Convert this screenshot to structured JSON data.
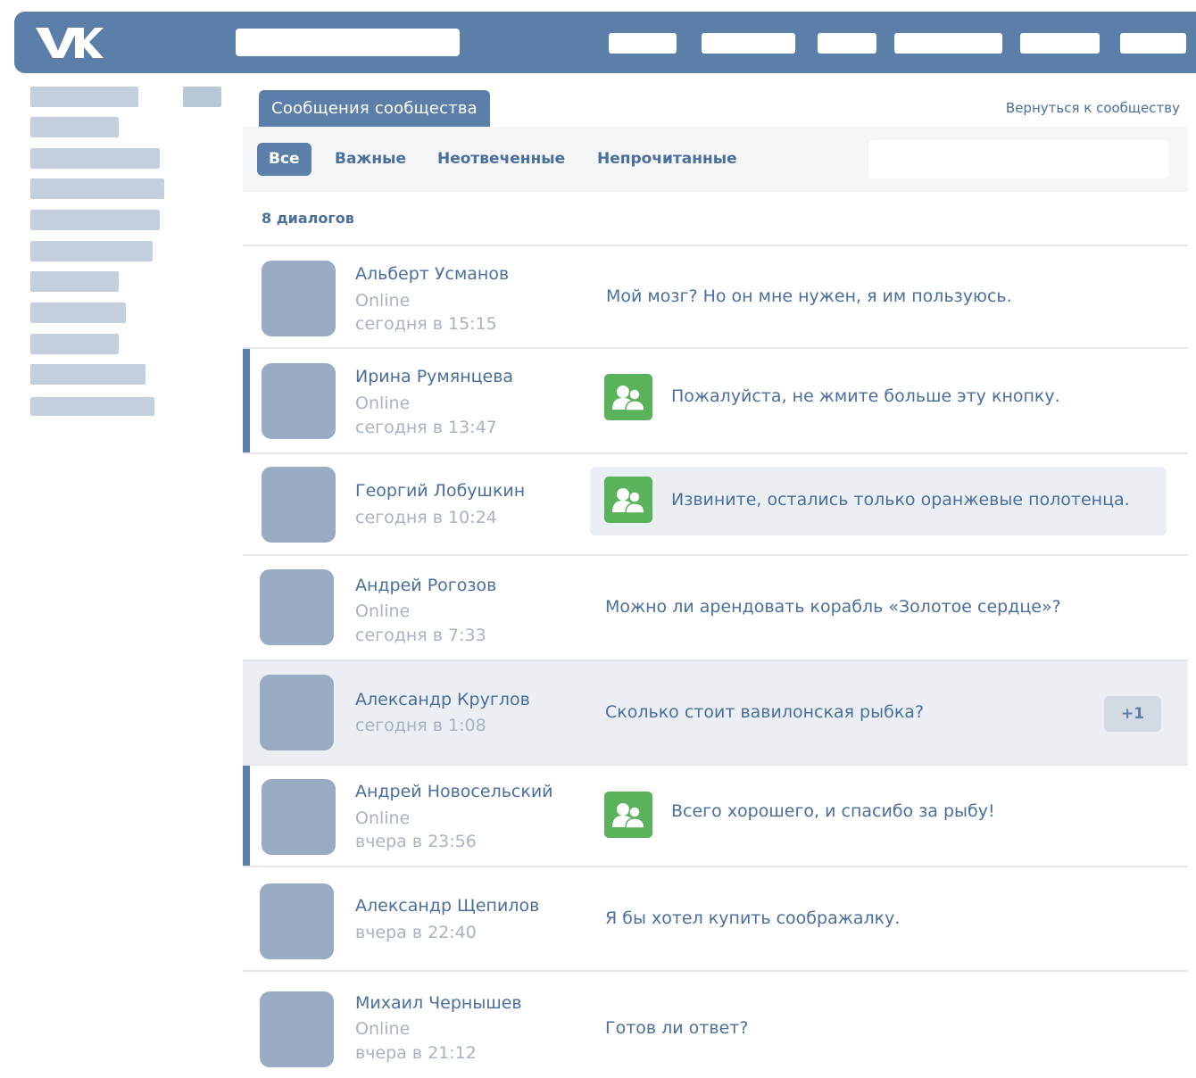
{
  "tabs": {
    "active_label": "Сообщения сообщества",
    "back_link": "Вернуться к сообществу"
  },
  "filters": {
    "all": "Все",
    "important": "Важные",
    "unanswered": "Неотвеченные",
    "unread": "Непрочитанные"
  },
  "dialog_count": "8 диалогов",
  "dialogs": [
    {
      "name": "Альберт Усманов",
      "online": "Online",
      "time": "сегодня в 15:15",
      "message": "Мой мозг? Но он мне нужен, я им пользуюсь."
    },
    {
      "name": "Ирина Румянцева",
      "online": "Online",
      "time": "сегодня в 13:47",
      "message": "Пожалуйста, не жмите больше эту кнопку.",
      "reply_icon": "community-icon"
    },
    {
      "name": "Георгий Лобушкин",
      "time": "сегодня в 10:24",
      "message": "Извините, остались только оранжевые полотенца.",
      "reply_icon": "community-icon"
    },
    {
      "name": "Андрей Рогозов",
      "online": "Online",
      "time": "сегодня в 7:33",
      "message": "Можно ли арендовать корабль «Золотое сердце»?"
    },
    {
      "name": "Александр Круглов",
      "time": "сегодня в 1:08",
      "message": "Сколько стоит вавилонская рыбка?",
      "badge": "+1"
    },
    {
      "name": "Андрей Новосельский",
      "online": "Online",
      "time": "вчера в 23:56",
      "message": "Всего хорошего, и спасибо за рыбу!",
      "reply_icon": "community-icon"
    },
    {
      "name": "Александр Щепилов",
      "time": "вчера в 22:40",
      "message": "Я бы хотел купить соображалку."
    },
    {
      "name": "Михаил Чернышев",
      "online": "Online",
      "time": "вчера в 21:12",
      "message": "Готов ли ответ?"
    }
  ],
  "colors": {
    "header": "#5b7fa8",
    "link": "#4a6f9c",
    "reply_icon": "#5ab35a",
    "avatar": "#9aacc3"
  }
}
